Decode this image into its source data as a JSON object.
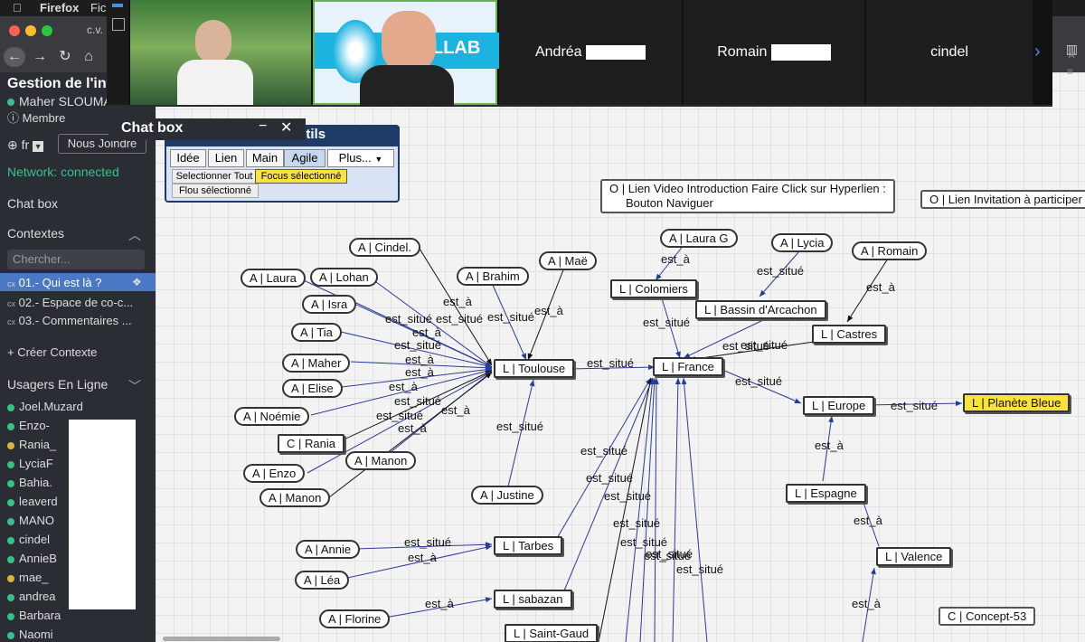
{
  "macbar": {
    "browser": "Firefox",
    "menu": "Fic"
  },
  "browser": {
    "tab_title": "c.v."
  },
  "app": {
    "title": "Gestion de l'int",
    "user": "Maher SLOUMA",
    "role": "Membre",
    "lang": "fr",
    "join_button": "Nous Joindre",
    "network": "Network: connected",
    "chat": "Chat box",
    "contexts_header": "Contextes",
    "search_placeholder": "Chercher...",
    "contexts": [
      "01.- Qui est là ?",
      "02.- Espace de co-c...",
      "03.- Commentaires ..."
    ],
    "ctx_prefix": "cx",
    "create_context": "Créer Contexte",
    "online_header": "Usagers En Ligne",
    "users": [
      "Joel.Muzard",
      "Enzo-",
      "Rania_",
      "LyciaF",
      "Bahia.",
      "leaverd",
      "MANO",
      "cindel",
      "AnnieB",
      "mae_",
      "andrea",
      "Barbara",
      "Naomi"
    ]
  },
  "video": {
    "names": [
      "Andréa",
      "Romain",
      "cindel"
    ],
    "next": "›",
    "logo_text": "LLAB"
  },
  "chatbox": {
    "title": "Chat box",
    "minimize": "−",
    "close": "✕"
  },
  "toolbar": {
    "title": "Barre d'outils",
    "tabs": [
      "Idée",
      "Lien",
      "Main",
      "Agile"
    ],
    "more": "Plus...",
    "select_all": "Selectionner Tout",
    "focus": "Focus sélectionné",
    "blur": "Flou sélectionné"
  },
  "graph": {
    "nodes": {
      "cindel": "A | Cindel.",
      "laura": "A | Laura",
      "lohan": "A | Lohan",
      "isra": "A | Isra",
      "tia": "A | Tia",
      "maher": "A | Maher",
      "elise": "A | Elise",
      "noemie": "A | Noémie",
      "rania": "C | Rania",
      "enzo": "A | Enzo",
      "manon1": "A | Manon",
      "manon2": "A | Manon",
      "brahim": "A | Brahim",
      "mae": "A | Maë",
      "toulouse": "L | Toulouse",
      "justine": "A | Justine",
      "laurag": "A | Laura G",
      "colomiers": "L | Colomiers",
      "lycia": "A | Lycia",
      "bassin": "L | Bassin d'Arcachon",
      "romain": "A | Romain",
      "castres": "L | Castres",
      "france": "L | France",
      "europe": "L | Europe",
      "planete": "L | Planète Bleue",
      "espagne": "L | Espagne",
      "valence": "L | Valence",
      "annie": "A | Annie",
      "lea": "A | Léa",
      "tarbes": "L | Tarbes",
      "florine": "A | Florine",
      "sabazan": "L | sabazan",
      "stgaud": "L | Saint-Gaud",
      "note1": "O | Lien Video Introduction Faire Click sur Hyperlien :",
      "note1b": "Bouton Naviguer",
      "note2": "O | Lien Invitation à participer",
      "concept": "C | Concept-53"
    },
    "rel": {
      "est_a": "est_à",
      "est_situe": "est_situé"
    }
  }
}
